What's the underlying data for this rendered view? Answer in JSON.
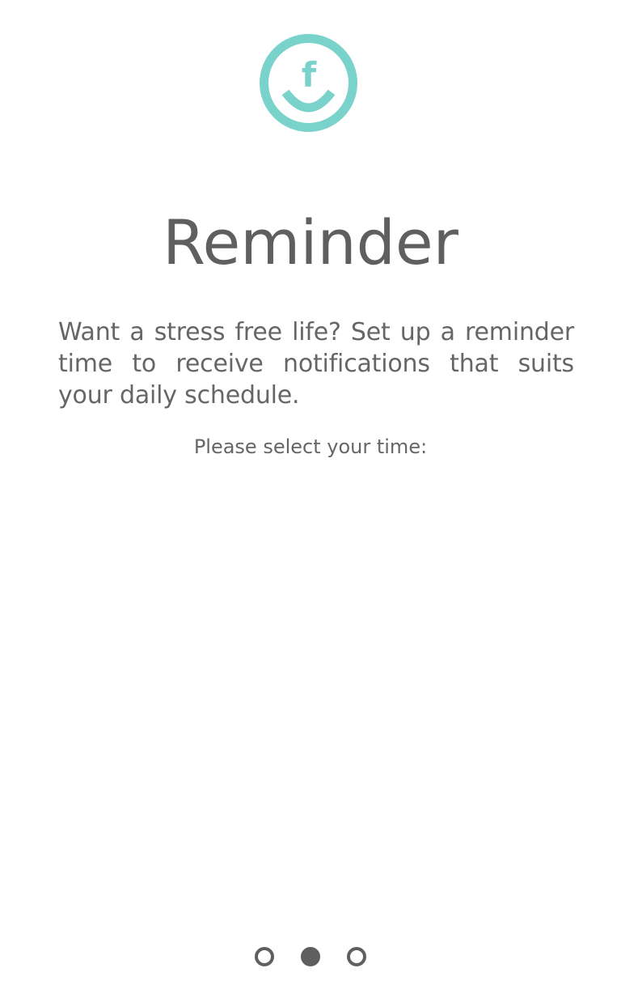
{
  "logo": {
    "letter": "f",
    "color": "#7ad3ca"
  },
  "title": "Reminder",
  "description": "Want a stress free life? Set up a reminder time to receive notifications that suits your daily schedule.",
  "prompt": "Please select your time:",
  "pager": {
    "count": 3,
    "active_index": 1,
    "color": "#5f5f5f"
  }
}
